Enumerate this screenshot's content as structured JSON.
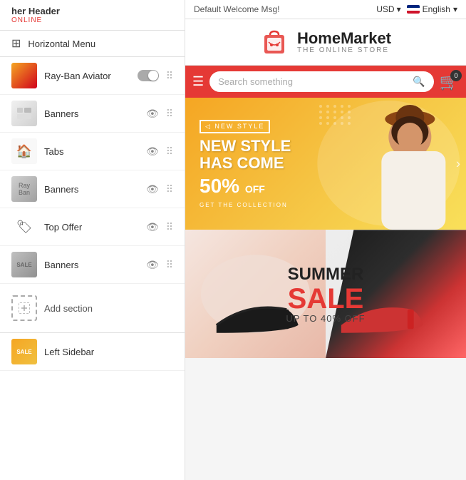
{
  "leftPanel": {
    "header": {
      "label": "her Header",
      "sublabel": "ONLINE"
    },
    "horizontalMenu": {
      "label": "Horizontal Menu"
    },
    "sections": [
      {
        "id": "rayban",
        "name": "Ray-Ban Aviator",
        "hasToggle": true,
        "thumbClass": "thumb-rayban"
      },
      {
        "id": "banners1",
        "name": "Banners",
        "hasToggle": false,
        "thumbClass": "thumb-banners1"
      },
      {
        "id": "tabs",
        "name": "Tabs",
        "hasToggle": false,
        "thumbClass": "thumb-tabs"
      },
      {
        "id": "banners2",
        "name": "Banners",
        "hasToggle": false,
        "thumbClass": "thumb-banners2"
      },
      {
        "id": "topoffer",
        "name": "Top Offer",
        "hasToggle": false,
        "thumbClass": "thumb-topoffer"
      },
      {
        "id": "banners3",
        "name": "Banners",
        "hasToggle": false,
        "thumbClass": "thumb-banners3"
      }
    ],
    "addSection": {
      "label": "Add section"
    },
    "leftSidebar": {
      "label": "Left Sidebar",
      "thumbClass": "thumb-leftsidebar"
    }
  },
  "rightPanel": {
    "topBar": {
      "welcomeMsg": "Default Welcome Msg!",
      "currency": "USD",
      "language": "English"
    },
    "store": {
      "name": "HomeMarket",
      "subtitle": "THE ONLINE STORE"
    },
    "navBar": {
      "searchPlaceholder": "Search something"
    },
    "cartBadge": "0",
    "banner": {
      "tag": "NEW STYLE",
      "titleLine1": "NEW STYLE",
      "titleLine2": "HAS COME",
      "discount": "50%",
      "discountLabel": "OFF",
      "cta": "GET THE COLLECTION"
    },
    "summerBanner": {
      "line1": "SUMMER",
      "line2": "SALE",
      "line3": "UP TO 40% OFF"
    }
  }
}
